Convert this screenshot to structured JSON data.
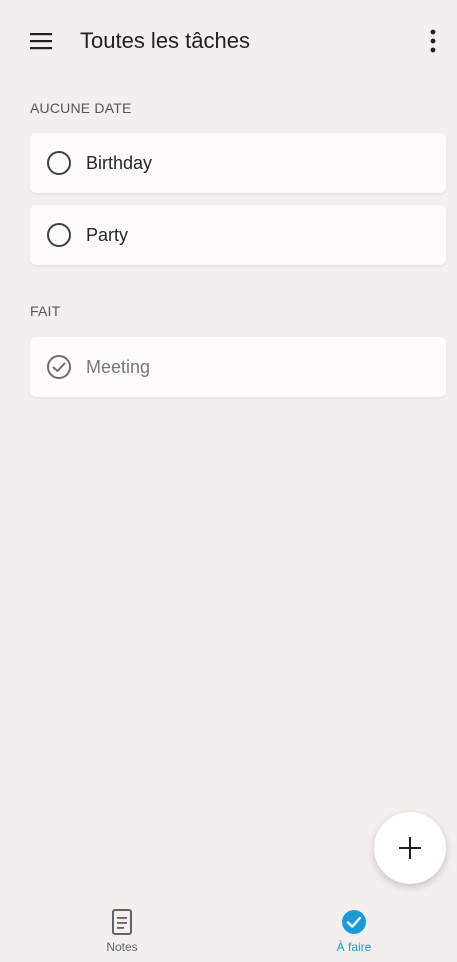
{
  "header": {
    "title": "Toutes les tâches",
    "menu_icon": "hamburger-menu-icon",
    "more_icon": "more-vert-icon"
  },
  "sections": [
    {
      "label": "AUCUNE DATE",
      "tasks": [
        {
          "text": "Birthday",
          "done": false
        },
        {
          "text": "Party",
          "done": false
        }
      ]
    },
    {
      "label": "FAIT",
      "tasks": [
        {
          "text": "Meeting",
          "done": true
        }
      ]
    }
  ],
  "fab": {
    "icon": "plus-icon"
  },
  "bottom_nav": {
    "items": [
      {
        "label": "Notes",
        "icon": "note-icon",
        "active": false
      },
      {
        "label": "À faire",
        "icon": "check-circle-icon",
        "active": true
      }
    ]
  },
  "colors": {
    "background": "#f2efec",
    "card": "#fdfcfb",
    "accent": "#1a9bd7"
  }
}
